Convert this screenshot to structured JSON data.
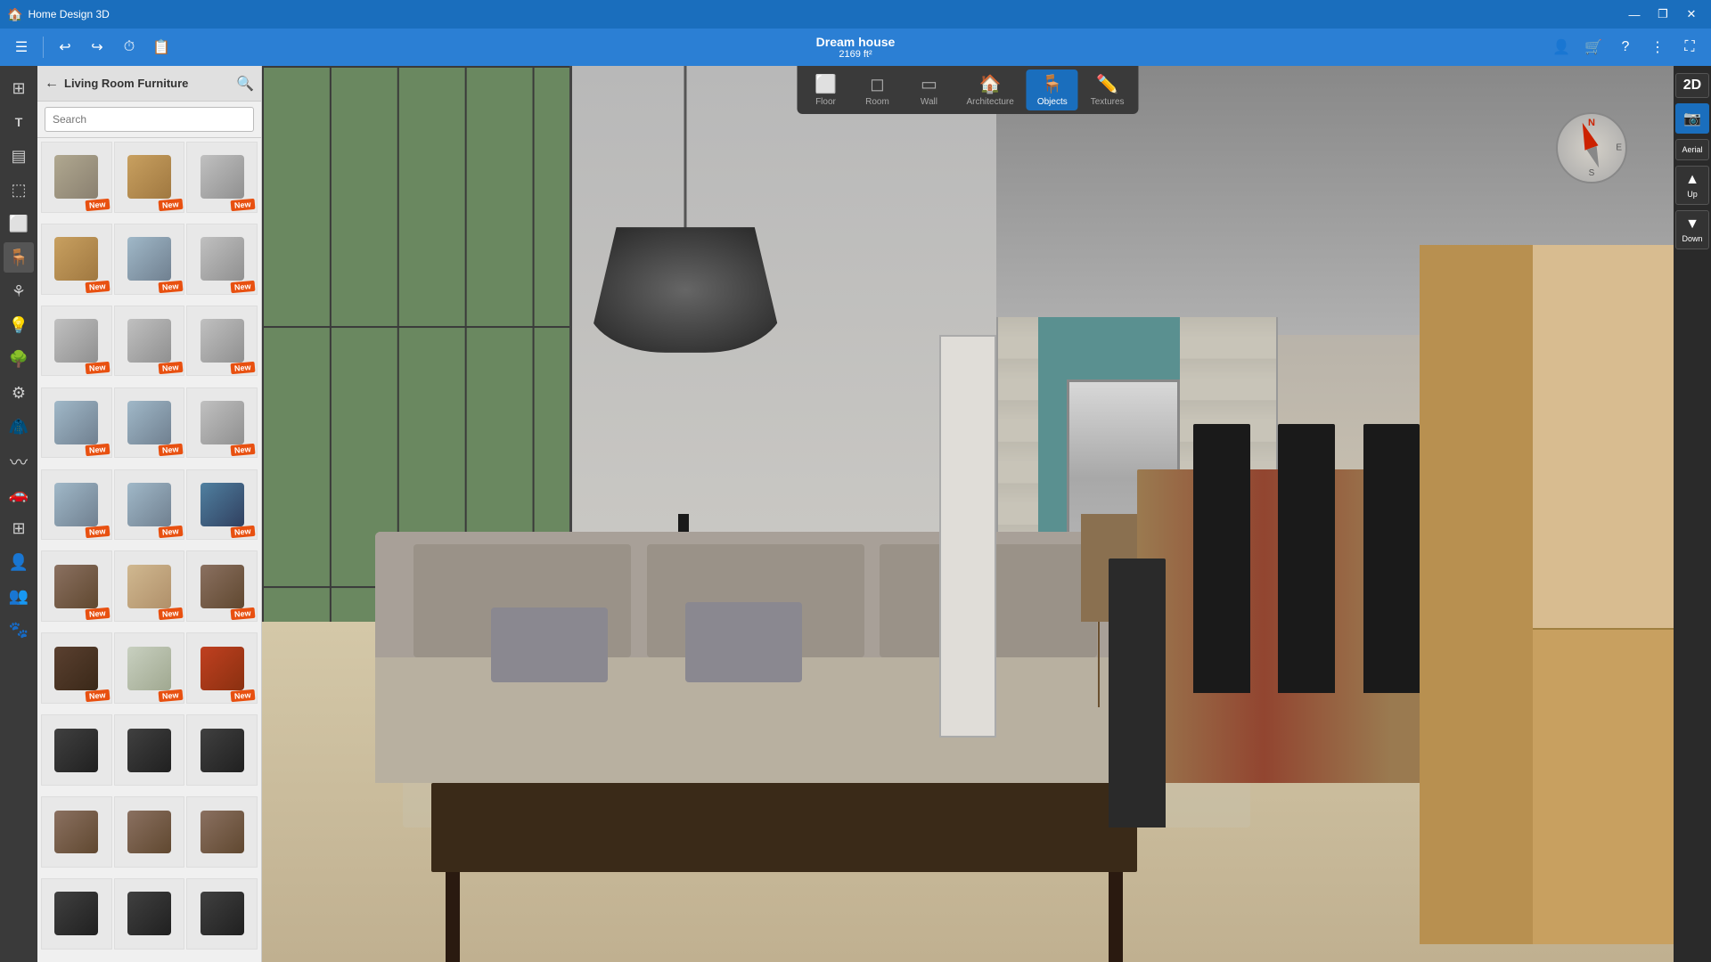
{
  "titleBar": {
    "appName": "Home Design 3D",
    "windowControls": {
      "minimize": "—",
      "maximize": "❐",
      "close": "✕"
    }
  },
  "toolbar": {
    "menu": "☰",
    "undo": "↩",
    "redo": "↪",
    "history": "⏱",
    "copy": "📋"
  },
  "project": {
    "name": "Dream house",
    "size": "2169 ft²"
  },
  "viewTabs": [
    {
      "id": "floor",
      "icon": "⬜",
      "label": "Floor"
    },
    {
      "id": "room",
      "icon": "◻",
      "label": "Room"
    },
    {
      "id": "wall",
      "icon": "▭",
      "label": "Wall"
    },
    {
      "id": "architecture",
      "icon": "🏠",
      "label": "Architecture"
    },
    {
      "id": "objects",
      "icon": "🪑",
      "label": "Objects",
      "active": true
    },
    {
      "id": "textures",
      "icon": "✏️",
      "label": "Textures"
    }
  ],
  "sidebarIcons": [
    {
      "id": "rooms",
      "icon": "⊞",
      "label": "Rooms"
    },
    {
      "id": "build",
      "icon": "T",
      "label": "Build"
    },
    {
      "id": "stairs",
      "icon": "▤",
      "label": "Stairs"
    },
    {
      "id": "windows",
      "icon": "⬚",
      "label": "Windows"
    },
    {
      "id": "doors",
      "icon": "⬜",
      "label": "Doors"
    },
    {
      "id": "furniture",
      "icon": "🪑",
      "label": "Furniture",
      "active": true
    },
    {
      "id": "decor",
      "icon": "⚘",
      "label": "Decor"
    },
    {
      "id": "lighting",
      "icon": "💡",
      "label": "Lighting"
    },
    {
      "id": "outdoor",
      "icon": "🌳",
      "label": "Outdoor"
    },
    {
      "id": "technical",
      "icon": "⚙",
      "label": "Technical"
    },
    {
      "id": "hanger",
      "icon": "🧥",
      "label": "Hanger"
    },
    {
      "id": "pool",
      "icon": "~",
      "label": "Pool"
    },
    {
      "id": "car",
      "icon": "🚗",
      "label": "Car"
    },
    {
      "id": "group1",
      "icon": "⊞",
      "label": "Group"
    },
    {
      "id": "person",
      "icon": "👤",
      "label": "Person"
    },
    {
      "id": "group2",
      "icon": "👥",
      "label": "Group2"
    },
    {
      "id": "animals",
      "icon": "🐾",
      "label": "Animals"
    }
  ],
  "panel": {
    "title": "Living Room Furniture",
    "searchPlaceholder": "Search",
    "backButton": "←",
    "searchIcon": "🔍"
  },
  "furnitureItems": [
    {
      "id": 1,
      "type": "sofa",
      "isNew": true
    },
    {
      "id": 2,
      "type": "bookcase",
      "isNew": true
    },
    {
      "id": 3,
      "type": "cabinet",
      "isNew": true
    },
    {
      "id": 4,
      "type": "bookcase",
      "isNew": true
    },
    {
      "id": 5,
      "type": "shelf",
      "isNew": true
    },
    {
      "id": 6,
      "type": "cabinet",
      "isNew": true
    },
    {
      "id": 7,
      "type": "cabinet",
      "isNew": true
    },
    {
      "id": 8,
      "type": "cabinet",
      "isNew": true
    },
    {
      "id": 9,
      "type": "cabinet",
      "isNew": true
    },
    {
      "id": 10,
      "type": "shelf",
      "isNew": true
    },
    {
      "id": 11,
      "type": "shelf",
      "isNew": true
    },
    {
      "id": 12,
      "type": "cabinet",
      "isNew": true
    },
    {
      "id": 13,
      "type": "shelf",
      "isNew": true
    },
    {
      "id": 14,
      "type": "shelf",
      "isNew": true
    },
    {
      "id": 15,
      "type": "blue",
      "isNew": true
    },
    {
      "id": 16,
      "type": "credenza",
      "isNew": true
    },
    {
      "id": 17,
      "type": "tan",
      "isNew": true
    },
    {
      "id": 18,
      "type": "credenza",
      "isNew": true
    },
    {
      "id": 19,
      "type": "dark",
      "isNew": true
    },
    {
      "id": 20,
      "type": "display",
      "isNew": true
    },
    {
      "id": 21,
      "type": "multi",
      "isNew": true
    },
    {
      "id": 22,
      "type": "tv",
      "isNew": false
    },
    {
      "id": 23,
      "type": "tv",
      "isNew": false
    },
    {
      "id": 24,
      "type": "tv",
      "isNew": false
    },
    {
      "id": 25,
      "type": "credenza",
      "isNew": false
    },
    {
      "id": 26,
      "type": "credenza",
      "isNew": false
    },
    {
      "id": 27,
      "type": "credenza",
      "isNew": false
    },
    {
      "id": 28,
      "type": "tv",
      "isNew": false
    },
    {
      "id": 29,
      "type": "tv",
      "isNew": false
    },
    {
      "id": 30,
      "type": "tv",
      "isNew": false
    }
  ],
  "newBadgeText": "New",
  "rightPanel": {
    "button2D": "2D",
    "aerial": "Aerial",
    "up": "Up",
    "down": "Down",
    "aerialIcon": "📷",
    "upIcon": "▲",
    "downIcon": "▼"
  },
  "compass": {
    "n": "N",
    "s": "S",
    "e": "E",
    "w": ""
  },
  "topRightIcons": [
    {
      "id": "users",
      "icon": "👤"
    },
    {
      "id": "cart",
      "icon": "🛒"
    },
    {
      "id": "help",
      "icon": "?"
    },
    {
      "id": "more",
      "icon": "⋮"
    },
    {
      "id": "expand",
      "icon": "⛶"
    }
  ]
}
